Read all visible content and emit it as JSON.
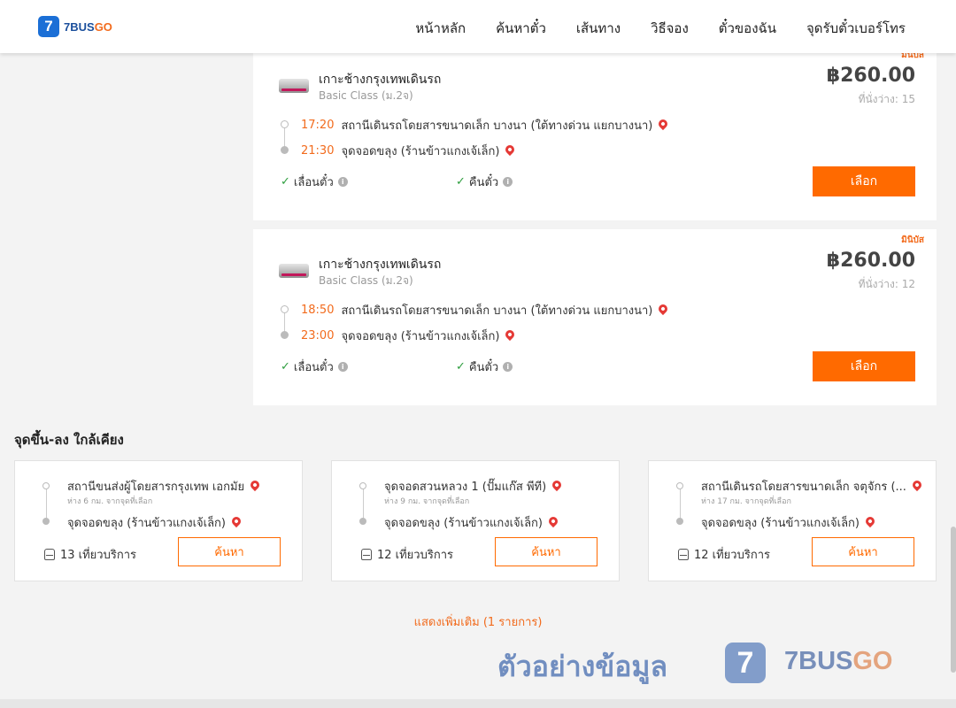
{
  "header": {
    "logo_mark": "7",
    "logo_text_a": "7BUS",
    "logo_text_b": "GO",
    "nav": [
      "หน้าหลัก",
      "ค้นหาตั๋ว",
      "เส้นทาง",
      "วิธีจอง",
      "ตั๋วของฉัน",
      "จุดรับตั๋วเบอร์โทร"
    ]
  },
  "trips": [
    {
      "tag": "มินิบัส",
      "operator": "เกาะช้างกรุงเทพเดินรถ",
      "class": "Basic Class (ม.2จ)",
      "price": "฿260.00",
      "seats": "ที่นั่งว่าง: 15",
      "depart_time": "17:20",
      "depart_place": "สถานีเดินรถโดยสารขนาดเล็ก บางนา (ใต้ทางด่วน แยกบางนา)",
      "arrive_time": "21:30",
      "arrive_place": "จุดจอดขลุง (ร้านข้าวแกงเจ้เล็ก)",
      "feature_1": "เลื่อนตั๋ว",
      "feature_2": "คืนตั๋ว",
      "select_label": "เลือก"
    },
    {
      "tag": "มินิบัส",
      "operator": "เกาะช้างกรุงเทพเดินรถ",
      "class": "Basic Class (ม.2จ)",
      "price": "฿260.00",
      "seats": "ที่นั่งว่าง: 12",
      "depart_time": "18:50",
      "depart_place": "สถานีเดินรถโดยสารขนาดเล็ก บางนา (ใต้ทางด่วน แยกบางนา)",
      "arrive_time": "23:00",
      "arrive_place": "จุดจอดขลุง (ร้านข้าวแกงเจ้เล็ก)",
      "feature_1": "เลื่อนตั๋ว",
      "feature_2": "คืนตั๋ว",
      "select_label": "เลือก"
    }
  ],
  "nearby": {
    "title": "จุดขึ้น-ลง ใกล้เคียง",
    "items": [
      {
        "from": "สถานีขนส่งผู้โดยสารกรุงเทพ เอกมัย",
        "distance": "ห่าง 6 กม. จากจุดที่เลือก",
        "to": "จุดจอดขลุง (ร้านข้าวแกงเจ้เล็ก)",
        "trips": "13 เที่ยวบริการ",
        "search_label": "ค้นหา"
      },
      {
        "from": "จุดจอดสวนหลวง 1 (ปั๊มแก๊ส พีที)",
        "distance": "ห่าง 9 กม. จากจุดที่เลือก",
        "to": "จุดจอดขลุง (ร้านข้าวแกงเจ้เล็ก)",
        "trips": "12 เที่ยวบริการ",
        "search_label": "ค้นหา"
      },
      {
        "from": "สถานีเดินรถโดยสารขนาดเล็ก จตุจักร (...",
        "distance": "ห่าง 17 กม. จากจุดที่เลือก",
        "to": "จุดจอดขลุง (ร้านข้าวแกงเจ้เล็ก)",
        "trips": "12 เที่ยวบริการ",
        "search_label": "ค้นหา"
      }
    ]
  },
  "show_more": "แสดงเพิ่มเติม (1 รายการ)",
  "watermark": {
    "text": "ตัวอย่างข้อมูล",
    "mark": "7",
    "brand_a": "7BUS",
    "brand_b": "GO"
  },
  "colors": {
    "accent": "#ff6a00",
    "time": "#f26b1d",
    "pin": "#e53935",
    "check": "#2e9e3f",
    "brand_blue": "#1b6fd6"
  },
  "icons": [
    "bus-logo-icon",
    "pin-icon",
    "check-icon",
    "info-icon",
    "bus-icon"
  ]
}
